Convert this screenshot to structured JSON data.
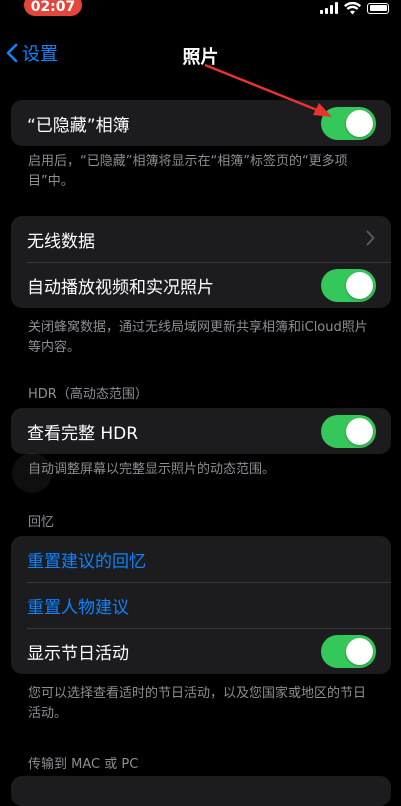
{
  "status": {
    "time": "02:07",
    "time_pill_color": "#e4463c"
  },
  "nav": {
    "back_label": "设置",
    "title": "照片",
    "accent": "#0a84ff"
  },
  "hidden_album": {
    "label": "“已隐藏”相簿",
    "toggle_on": true,
    "footnote": "启用后，“已隐藏”相簿将显示在“相簿”标签页的“更多项目”中。"
  },
  "cellular": {
    "wireless_label": "无线数据",
    "autoplay_label": "自动播放视频和实况照片",
    "autoplay_on": true,
    "footnote": "关闭蜂窝数据，通过无线局域网更新共享相簿和iCloud照片等内容。"
  },
  "hdr": {
    "header": "HDR（高动态范围）",
    "full_hdr_label": "查看完整 HDR",
    "full_hdr_on": true,
    "footnote": "自动调整屏幕以完整显示照片的动态范围。"
  },
  "memories": {
    "header": "回忆",
    "reset_suggestions_label": "重置建议的回忆",
    "reset_people_label": "重置人物建议",
    "holiday_label": "显示节日活动",
    "holiday_on": true,
    "footnote": "您可以选择查看适时的节日活动，以及您国家或地区的节日活动。"
  },
  "transfer": {
    "header": "传输到 MAC 或 PC"
  },
  "colors": {
    "toggle_on": "#34c759",
    "annotation_arrow": "#e8332f"
  }
}
